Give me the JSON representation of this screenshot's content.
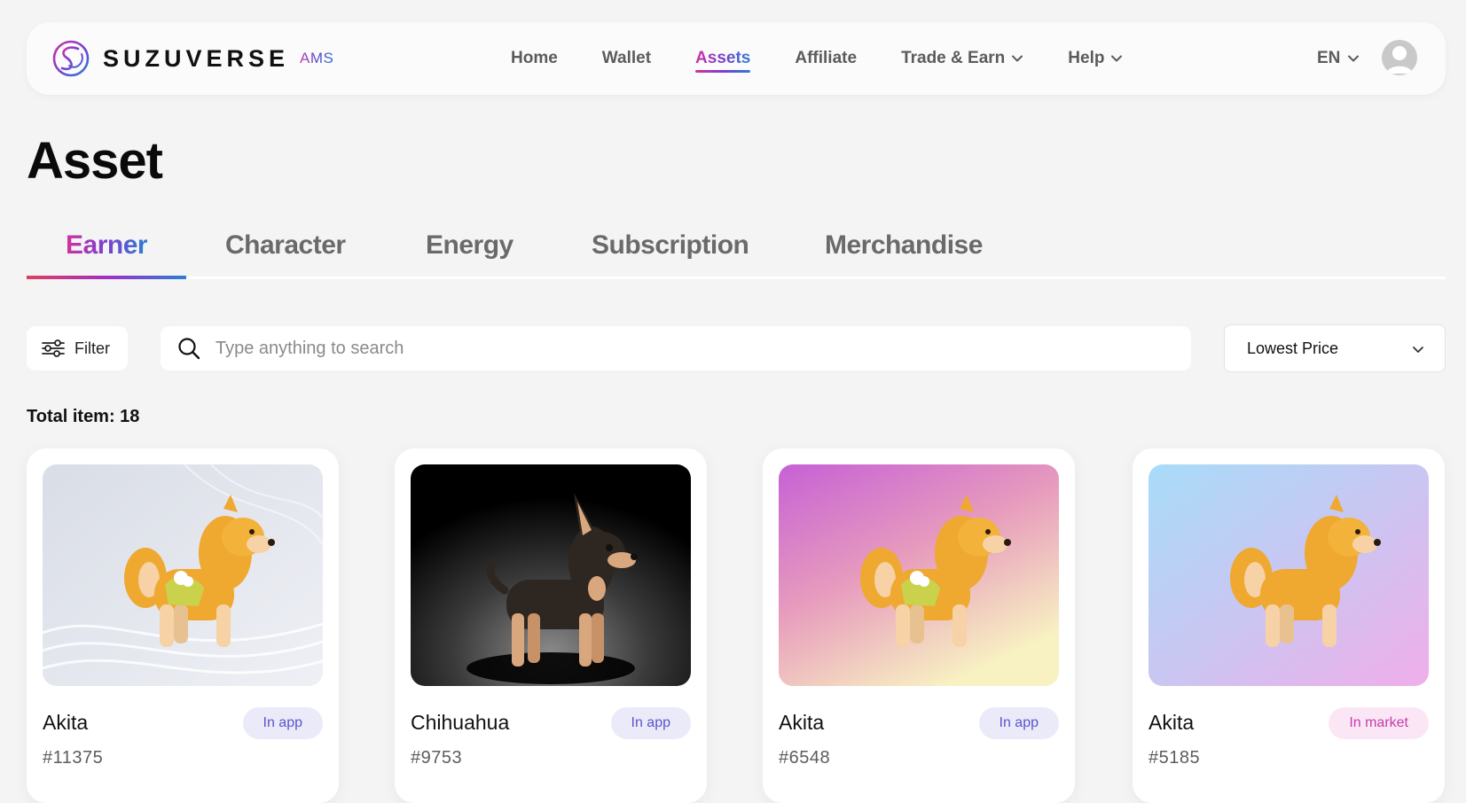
{
  "header": {
    "brand_name": "SUZUVERSE",
    "brand_sub": "AMS",
    "nav": [
      {
        "label": "Home"
      },
      {
        "label": "Wallet"
      },
      {
        "label": "Assets"
      },
      {
        "label": "Affiliate"
      },
      {
        "label": "Trade & Earn"
      },
      {
        "label": "Help"
      }
    ],
    "language": "EN",
    "active_nav": "Assets"
  },
  "page": {
    "title": "Asset",
    "tabs": [
      {
        "label": "Earner"
      },
      {
        "label": "Character"
      },
      {
        "label": "Energy"
      },
      {
        "label": "Subscription"
      },
      {
        "label": "Merchandise"
      }
    ],
    "active_tab": "Earner"
  },
  "toolbar": {
    "filter_label": "Filter",
    "search_placeholder": "Type anything to search",
    "sort_value": "Lowest Price"
  },
  "summary": {
    "total_label": "Total item: 18"
  },
  "cards": [
    {
      "name": "Akita",
      "id": "#11375",
      "status": "In app",
      "breed_icon": "akita-dog",
      "background": "silver-waves"
    },
    {
      "name": "Chihuahua",
      "id": "#9753",
      "status": "In app",
      "breed_icon": "chihuahua-dog",
      "background": "black-spotlight"
    },
    {
      "name": "Akita",
      "id": "#6548",
      "status": "In app",
      "breed_icon": "akita-dog",
      "background": "pink-sunset-gradient"
    },
    {
      "name": "Akita",
      "id": "#5185",
      "status": "In market",
      "breed_icon": "akita-dog",
      "background": "blue-pink-gradient"
    }
  ],
  "colors": {
    "accent_pink": "#d0339f",
    "accent_purple": "#7b3fd0",
    "accent_blue": "#2b7ed6",
    "badge_app_text": "#5b55c8",
    "badge_market_text": "#c13eac"
  }
}
